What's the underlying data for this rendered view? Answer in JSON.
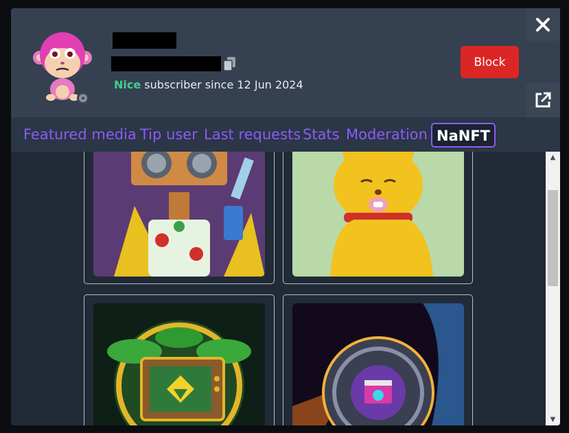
{
  "profile": {
    "rank_label": "Nice",
    "since_text": " subscriber since 12 Jun 2024"
  },
  "header": {
    "block_label": "Block"
  },
  "tabs": [
    {
      "label": "Featured media"
    },
    {
      "label": "Tip user"
    },
    {
      "label": "Last requests"
    },
    {
      "label": "Stats"
    },
    {
      "label": "Moderation"
    },
    {
      "label": "NaNFT",
      "active": true
    }
  ],
  "nfts": [
    {
      "name": "robot-nft",
      "icon": "robot-art"
    },
    {
      "name": "cat-nft",
      "icon": "cat-art"
    },
    {
      "name": "jungle-tv-nft",
      "icon": "tv-art"
    },
    {
      "name": "coin-nft",
      "icon": "coin-art"
    }
  ],
  "colors": {
    "accent": "#8b5cf6",
    "block": "#dc2626",
    "rank": "#3fcf8e",
    "header_bg": "#354151",
    "body_bg": "#212a37"
  }
}
